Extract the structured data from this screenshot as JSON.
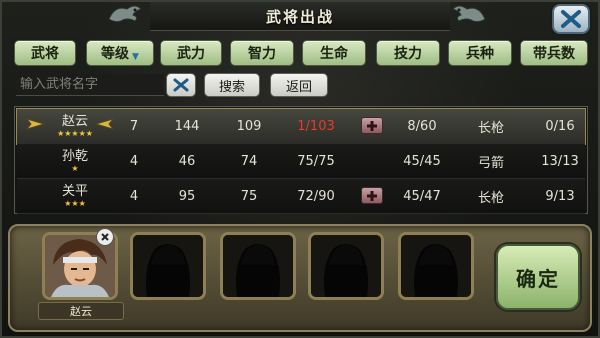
{
  "window": {
    "title": "武将出战"
  },
  "tabs": [
    {
      "label": "武将"
    },
    {
      "label": "等级"
    },
    {
      "label": "武力"
    },
    {
      "label": "智力"
    },
    {
      "label": "生命"
    },
    {
      "label": "技力"
    },
    {
      "label": "兵种"
    },
    {
      "label": "带兵数"
    }
  ],
  "search": {
    "placeholder": "输入武将名字",
    "search_label": "搜索",
    "back_label": "返回"
  },
  "generals": [
    {
      "name": "赵云",
      "stars": "★★★★★",
      "level": "7",
      "force": "144",
      "intel": "109",
      "hp": "1/103",
      "skill": "8/60",
      "troop": "长枪",
      "count": "0/16"
    },
    {
      "name": "孙乾",
      "stars": "★",
      "level": "4",
      "force": "46",
      "intel": "74",
      "hp": "75/75",
      "skill": "45/45",
      "troop": "弓箭",
      "count": "13/13"
    },
    {
      "name": "关平",
      "stars": "★★★",
      "level": "4",
      "force": "95",
      "intel": "75",
      "hp": "72/90",
      "skill": "45/47",
      "troop": "长枪",
      "count": "9/13"
    }
  ],
  "lineup": {
    "slot1_name": "赵云",
    "confirm_label": "确定"
  },
  "colors": {
    "accent": "#9fbd84",
    "hp_low": "#e43c2c",
    "star": "#f2c53a",
    "frame": "#8f7f55"
  },
  "icons": [
    "dragon-icon",
    "close-icon",
    "dropdown-icon",
    "clear-icon",
    "wing-icon",
    "plus-icon",
    "hero-silhouette-icon"
  ]
}
